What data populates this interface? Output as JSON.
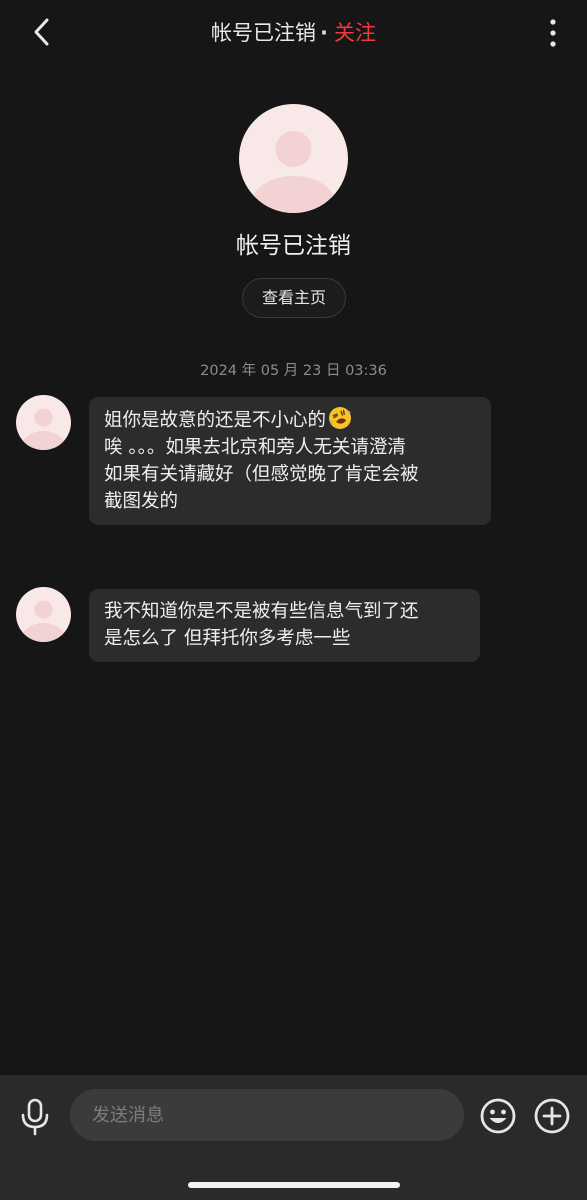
{
  "header": {
    "title": "帐号已注销",
    "dot": "·",
    "follow_label": "关注"
  },
  "profile": {
    "name": "帐号已注销",
    "home_button_label": "查看主页"
  },
  "conversation": {
    "timestamp": "2024 年 05 月 23 日 03:36",
    "messages": [
      {
        "lines": [
          "姐你是故意的还是不小心的",
          "唉 。。。如果去北京和旁人无关请澄清",
          "如果有关请藏好（但感觉晚了肯定会被",
          "截图发的"
        ],
        "emoji": "rofl-emoji"
      },
      {
        "lines": [
          "我不知道你是不是被有些信息气到了还",
          "是怎么了 但拜托你多考虑一些"
        ]
      }
    ]
  },
  "input": {
    "placeholder": "发送消息"
  },
  "colors": {
    "background": "#161616",
    "bubble": "#2c2c2c",
    "accent_follow": "#f0393d",
    "avatar_bg": "#f8e8e8",
    "avatar_fg": "#f2d2d2",
    "bottom_bar": "#2a2a2a"
  },
  "icons": {
    "back": "chevron-left-icon",
    "more": "more-vertical-icon",
    "mic": "microphone-icon",
    "emoji": "smiley-icon",
    "plus": "plus-circle-icon"
  }
}
